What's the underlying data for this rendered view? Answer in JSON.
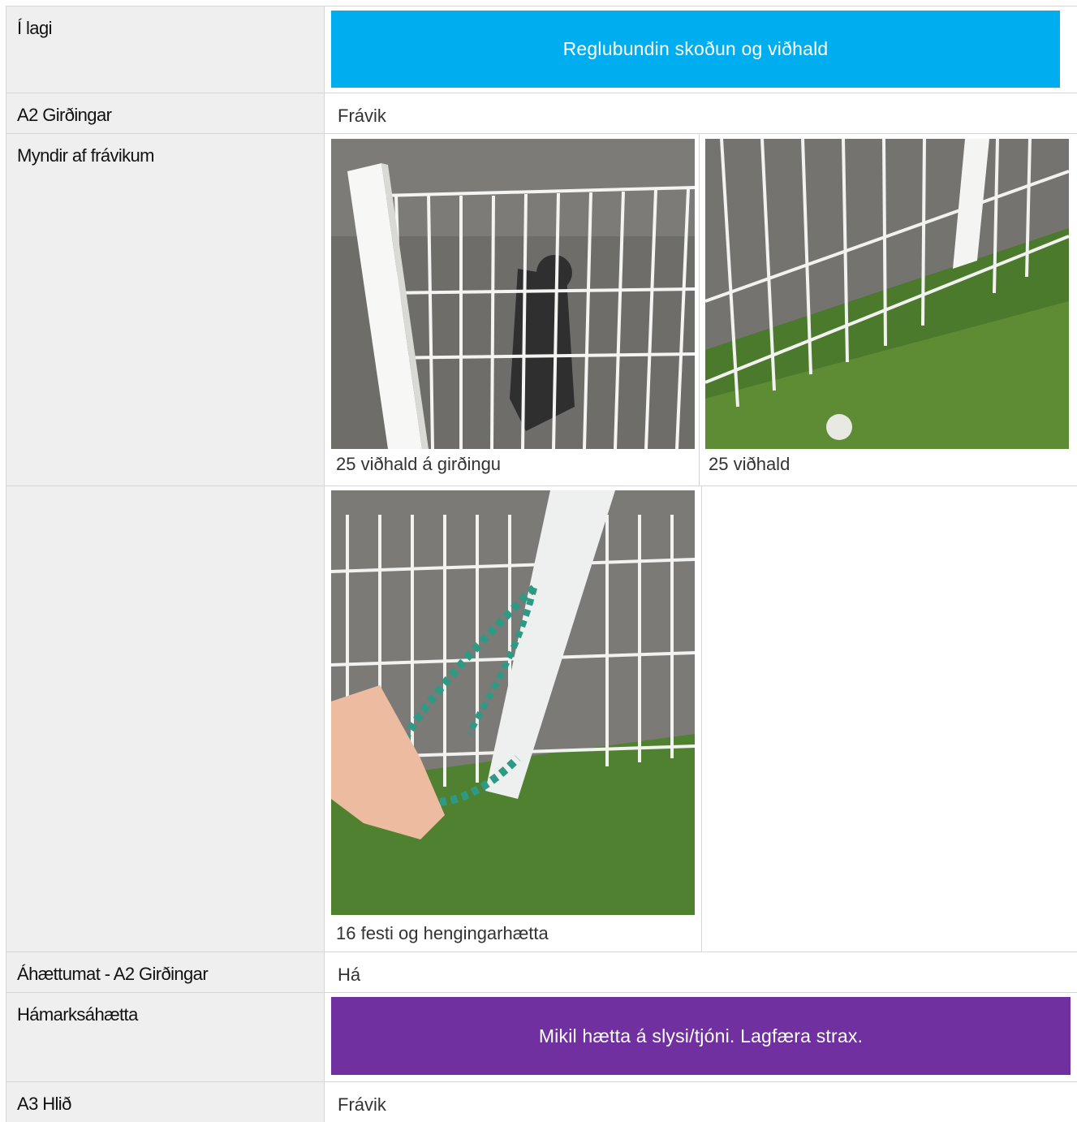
{
  "rows": [
    {
      "label": "Í lagi",
      "banner": "Reglubundin skoðun og viðhald",
      "banner_color": "#00aeef"
    },
    {
      "label": "A2 Girðingar",
      "value": "Frávik"
    },
    {
      "label": "Myndir af frávikum",
      "photos": [
        {
          "caption": "25 viðhald á girðingu"
        },
        {
          "caption": "25 viðhald"
        }
      ]
    },
    {
      "label": "",
      "photos": [
        {
          "caption": "16 festi og hengingarhætta"
        }
      ]
    },
    {
      "label": "Áhættumat - A2 Girðingar",
      "value": "Há"
    },
    {
      "label": "Hámarksáhætta",
      "banner": "Mikil hætta á slysi/tjóni. Lagfæra strax.",
      "banner_color": "#7030a0"
    },
    {
      "label": "A3 Hlið",
      "value": "Frávik"
    }
  ],
  "colors": {
    "label_bg": "#efefef",
    "border": "#d6d6d6"
  }
}
